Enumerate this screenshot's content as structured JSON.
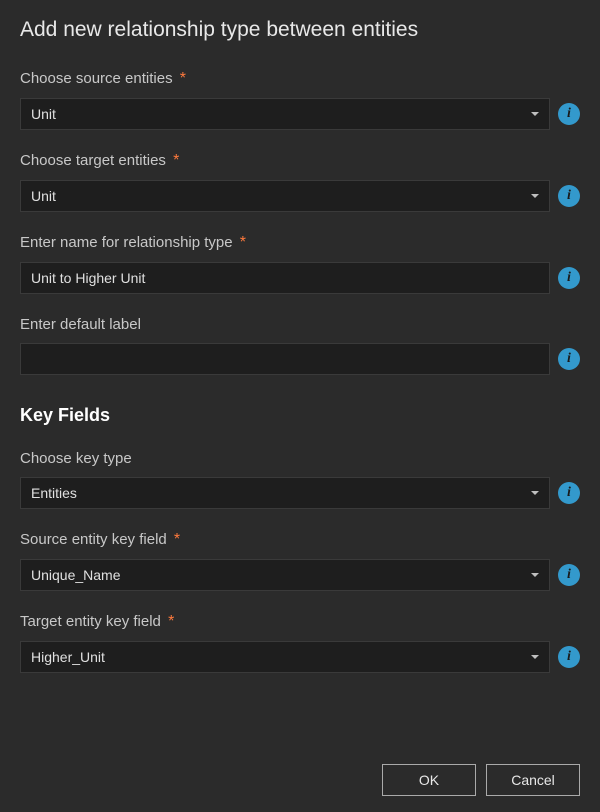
{
  "title": "Add new relationship type between entities",
  "fields": {
    "source_entities": {
      "label": "Choose source entities",
      "value": "Unit",
      "required": true
    },
    "target_entities": {
      "label": "Choose target entities",
      "value": "Unit",
      "required": true
    },
    "relationship_name": {
      "label": "Enter name for relationship type",
      "value": "Unit to Higher Unit",
      "required": true
    },
    "default_label": {
      "label": "Enter default label",
      "value": "",
      "required": false
    }
  },
  "key_fields_section": {
    "header": "Key Fields",
    "key_type": {
      "label": "Choose key type",
      "value": "Entities",
      "required": false
    },
    "source_key_field": {
      "label": "Source entity key field",
      "value": "Unique_Name",
      "required": true
    },
    "target_key_field": {
      "label": "Target entity key field",
      "value": "Higher_Unit",
      "required": true
    }
  },
  "buttons": {
    "ok": "OK",
    "cancel": "Cancel"
  },
  "required_marker": "*"
}
